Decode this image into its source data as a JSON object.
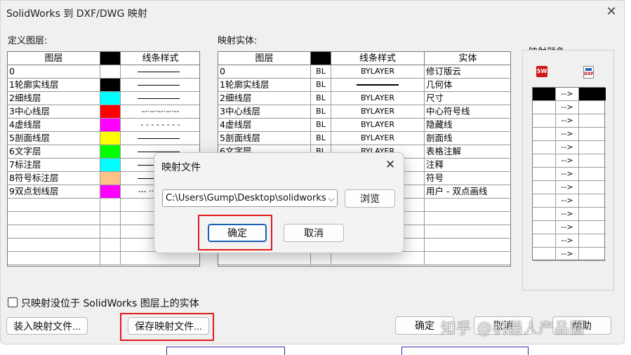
{
  "window": {
    "title": "SolidWorks 到 DXF/DWG 映射",
    "close_glyph": "✕"
  },
  "left_panel": {
    "label": "定义图层:",
    "headers": [
      "图层",
      "",
      "线条样式"
    ],
    "rows": [
      {
        "name": "0",
        "color": "#ffffff",
        "style": "solid"
      },
      {
        "name": "1轮廓实线层",
        "color": "#000000",
        "style": "solid"
      },
      {
        "name": "2细线层",
        "color": "#00ffff",
        "style": "solid"
      },
      {
        "name": "3中心线层",
        "color": "#ff0000",
        "style": "center"
      },
      {
        "name": "4虚线层",
        "color": "#ff00ff",
        "style": "dashed"
      },
      {
        "name": "5剖面线层",
        "color": "#ffff00",
        "style": "solid"
      },
      {
        "name": "6文字层",
        "color": "#00ff00",
        "style": "solid"
      },
      {
        "name": "7标注层",
        "color": "#00ffff",
        "style": "solid"
      },
      {
        "name": "8符号标注层",
        "color": "#ffc38a",
        "style": "solid"
      },
      {
        "name": "9双点划线层",
        "color": "#ff00ff",
        "style": "phantom"
      }
    ]
  },
  "mid_panel": {
    "label": "映射实体:",
    "headers": [
      "图层",
      "",
      "线条样式",
      "实体"
    ],
    "rows": [
      {
        "layer": "0",
        "bl": "BL",
        "style": "BYLAYER",
        "entity": "修订版云"
      },
      {
        "layer": "1轮廓实线层",
        "bl": "BL",
        "style": "",
        "entity": "几何体"
      },
      {
        "layer": "2细线层",
        "bl": "BL",
        "style": "BYLAYER",
        "entity": "尺寸"
      },
      {
        "layer": "3中心线层",
        "bl": "BL",
        "style": "BYLAYER",
        "entity": "中心符号线"
      },
      {
        "layer": "4虚线层",
        "bl": "BL",
        "style": "BYLAYER",
        "entity": "隐藏线"
      },
      {
        "layer": "5剖面线层",
        "bl": "BL",
        "style": "BYLAYER",
        "entity": "剖面线"
      },
      {
        "layer": "6文字层",
        "bl": "BL",
        "style": "BYLAYER",
        "entity": "表格注解"
      },
      {
        "layer": "",
        "bl": "",
        "style": "",
        "entity": "注释"
      },
      {
        "layer": "",
        "bl": "",
        "style": "",
        "entity": "符号"
      },
      {
        "layer": "",
        "bl": "",
        "style": "",
        "entity": "用户 - 双点画线"
      }
    ]
  },
  "color_panel": {
    "label": "映射颜色",
    "sw_icon": "SW",
    "dxf_icon": "DXF",
    "arrow": "-->",
    "rows": 13
  },
  "bottom": {
    "checkbox_label": "只映射没位于 SolidWorks 图层上的实体",
    "load_button": "装入映射文件...",
    "save_button": "保存映射文件...",
    "ok_button": "确定",
    "cancel_button": "取消",
    "help_button": "帮助"
  },
  "watermark": "知乎 @机器人产品圈",
  "modal": {
    "title": "映射文件",
    "close_glyph": "✕",
    "path_value": "C:\\Users\\Gump\\Desktop\\solidworks工",
    "dropdown_glyph": "⌵",
    "browse_button": "浏览",
    "ok_button": "确定",
    "cancel_button": "取消"
  }
}
